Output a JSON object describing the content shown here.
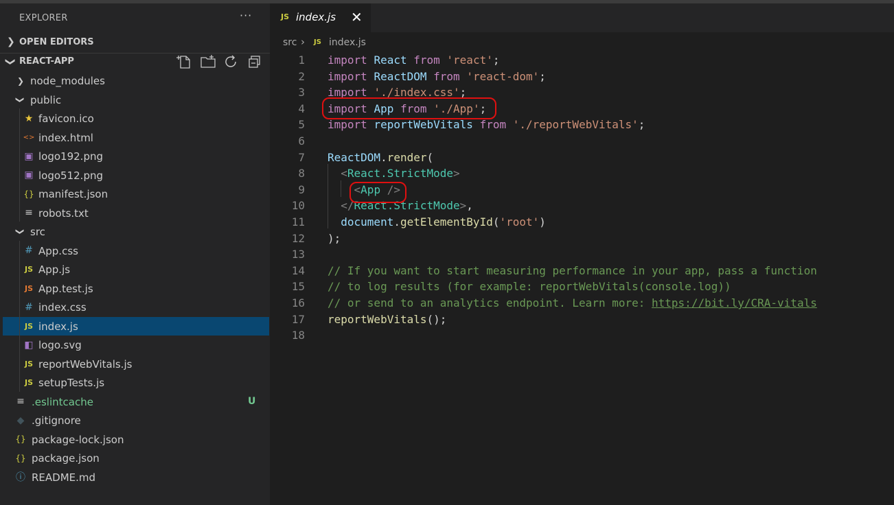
{
  "sidebar": {
    "title": "EXPLORER",
    "more_icon": "ellipsis-icon",
    "open_editors_label": "OPEN EDITORS",
    "project_label": "REACT-APP",
    "actions": [
      "new-file-icon",
      "new-folder-icon",
      "refresh-icon",
      "collapse-all-icon"
    ],
    "tree": [
      {
        "label": "node_modules",
        "kind": "folder",
        "depth": 1,
        "expanded": false
      },
      {
        "label": "public",
        "kind": "folder",
        "depth": 1,
        "expanded": true
      },
      {
        "label": "favicon.ico",
        "kind": "star",
        "depth": 2
      },
      {
        "label": "index.html",
        "kind": "html",
        "depth": 2
      },
      {
        "label": "logo192.png",
        "kind": "image",
        "depth": 2
      },
      {
        "label": "logo512.png",
        "kind": "image",
        "depth": 2
      },
      {
        "label": "manifest.json",
        "kind": "json",
        "depth": 2
      },
      {
        "label": "robots.txt",
        "kind": "text",
        "depth": 2
      },
      {
        "label": "src",
        "kind": "folder",
        "depth": 1,
        "expanded": true
      },
      {
        "label": "App.css",
        "kind": "css",
        "depth": 2
      },
      {
        "label": "App.js",
        "kind": "js",
        "depth": 2
      },
      {
        "label": "App.test.js",
        "kind": "test",
        "depth": 2
      },
      {
        "label": "index.css",
        "kind": "css",
        "depth": 2
      },
      {
        "label": "index.js",
        "kind": "js",
        "depth": 2,
        "active": true
      },
      {
        "label": "logo.svg",
        "kind": "svg",
        "depth": 2
      },
      {
        "label": "reportWebVitals.js",
        "kind": "js",
        "depth": 2
      },
      {
        "label": "setupTests.js",
        "kind": "js",
        "depth": 2
      },
      {
        "label": ".eslintcache",
        "kind": "text",
        "depth": 1,
        "badge": "U",
        "untracked": true
      },
      {
        "label": ".gitignore",
        "kind": "git",
        "depth": 1
      },
      {
        "label": "package-lock.json",
        "kind": "json",
        "depth": 1
      },
      {
        "label": "package.json",
        "kind": "json",
        "depth": 1
      },
      {
        "label": "README.md",
        "kind": "info",
        "depth": 1
      }
    ]
  },
  "editor": {
    "tab": {
      "icon_text": "JS",
      "label": "index.js",
      "close": "✕"
    },
    "breadcrumb": {
      "folder": "src",
      "icon_text": "JS",
      "file": "index.js"
    },
    "lines": [
      [
        [
          "kw",
          "import "
        ],
        [
          "id",
          "React "
        ],
        [
          "kw",
          "from "
        ],
        [
          "st",
          "'react'"
        ],
        [
          "pl",
          ";"
        ]
      ],
      [
        [
          "kw",
          "import "
        ],
        [
          "id",
          "ReactDOM "
        ],
        [
          "kw",
          "from "
        ],
        [
          "st",
          "'react-dom'"
        ],
        [
          "pl",
          ";"
        ]
      ],
      [
        [
          "kw",
          "import "
        ],
        [
          "st",
          "'./index.css'"
        ],
        [
          "pl",
          ";"
        ]
      ],
      [
        [
          "kw",
          "import "
        ],
        [
          "id",
          "App "
        ],
        [
          "kw",
          "from "
        ],
        [
          "st",
          "'./App'"
        ],
        [
          "pl",
          ";"
        ]
      ],
      [
        [
          "kw",
          "import "
        ],
        [
          "id",
          "reportWebVitals "
        ],
        [
          "kw",
          "from "
        ],
        [
          "st",
          "'./reportWebVitals'"
        ],
        [
          "pl",
          ";"
        ]
      ],
      [],
      [
        [
          "id",
          "ReactDOM"
        ],
        [
          "pl",
          "."
        ],
        [
          "fn",
          "render"
        ],
        [
          "pl",
          "("
        ]
      ],
      [
        [
          "pl",
          "  "
        ],
        [
          "br",
          "<"
        ],
        [
          "tg",
          "React.StrictMode"
        ],
        [
          "br",
          ">"
        ]
      ],
      [
        [
          "pl",
          "    "
        ],
        [
          "br",
          "<"
        ],
        [
          "tg",
          "App"
        ],
        [
          "pl",
          " "
        ],
        [
          "br",
          "/>"
        ]
      ],
      [
        [
          "pl",
          "  "
        ],
        [
          "br",
          "</"
        ],
        [
          "tg",
          "React.StrictMode"
        ],
        [
          "br",
          ">"
        ],
        [
          "pl",
          ","
        ]
      ],
      [
        [
          "pl",
          "  "
        ],
        [
          "id",
          "document"
        ],
        [
          "pl",
          "."
        ],
        [
          "fn",
          "getElementById"
        ],
        [
          "pl",
          "("
        ],
        [
          "st",
          "'root'"
        ],
        [
          "pl",
          ")"
        ]
      ],
      [
        [
          "pl",
          ");"
        ]
      ],
      [],
      [
        [
          "cm",
          "// If you want to start measuring performance in your app, pass a function"
        ]
      ],
      [
        [
          "cm",
          "// to log results (for example: reportWebVitals(console.log))"
        ]
      ],
      [
        [
          "cm",
          "// or send to an analytics endpoint. Learn more: "
        ],
        [
          "cmu",
          "https://bit.ly/CRA-vitals"
        ]
      ],
      [
        [
          "fn",
          "reportWebVitals"
        ],
        [
          "pl",
          "();"
        ]
      ],
      []
    ]
  },
  "colors": {
    "sidebar_bg": "#252526",
    "editor_bg": "#1e1e1e",
    "active_row": "#094771",
    "annotation": "#e01010"
  }
}
